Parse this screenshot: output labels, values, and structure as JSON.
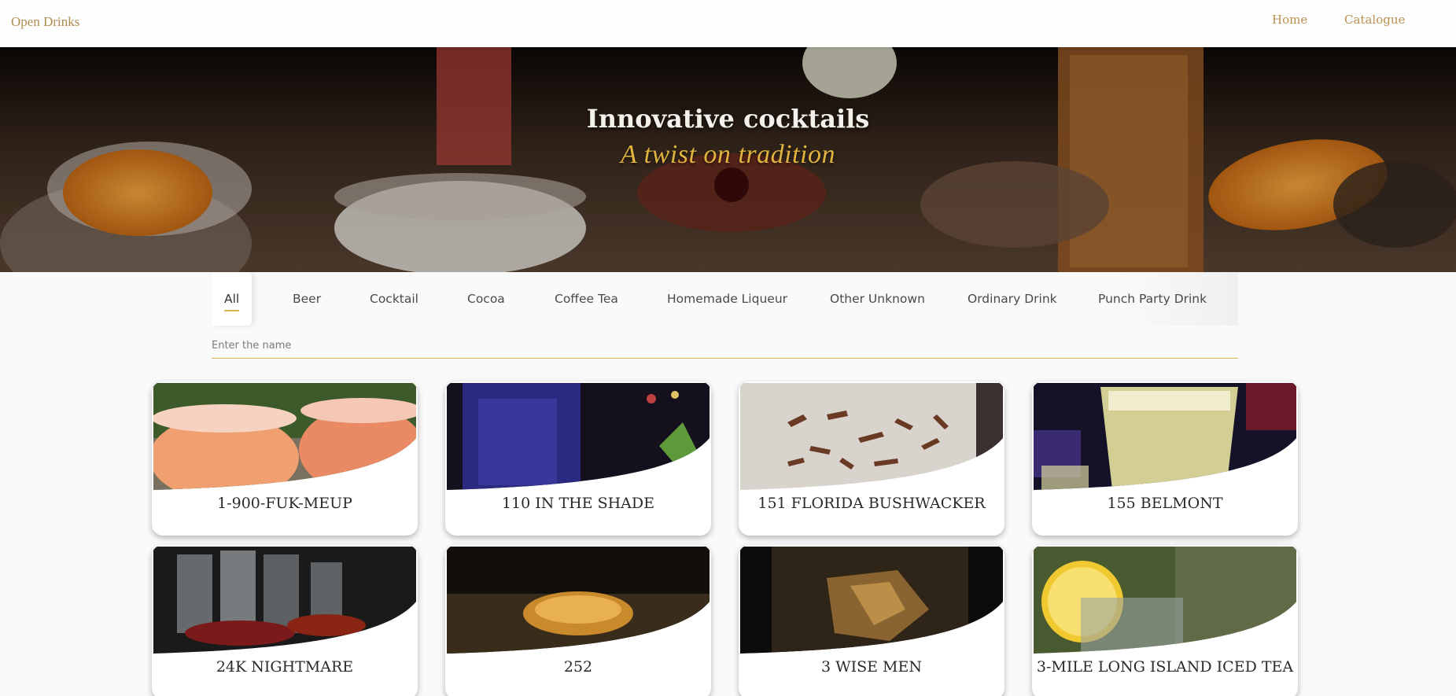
{
  "header": {
    "brand": "Open Drinks",
    "nav": [
      {
        "label": "Home"
      },
      {
        "label": "Catalogue"
      }
    ]
  },
  "hero": {
    "title": "Innovative cocktails",
    "subtitle": "A twist on tradition"
  },
  "tabs": {
    "active": "All",
    "items": [
      {
        "label": "All"
      },
      {
        "label": "Beer"
      },
      {
        "label": "Cocktail"
      },
      {
        "label": "Cocoa"
      },
      {
        "label": "Coffee Tea"
      },
      {
        "label": "Homemade Liqueur"
      },
      {
        "label": "Other Unknown"
      },
      {
        "label": "Ordinary Drink"
      },
      {
        "label": "Punch Party Drink"
      }
    ]
  },
  "search": {
    "placeholder": "Enter the name",
    "value": ""
  },
  "drinks": [
    {
      "name": "1-900-FUK-MEUP",
      "image": "pink-slush-cups"
    },
    {
      "name": "110 IN THE SHADE",
      "image": "blue-jar-mint"
    },
    {
      "name": "151 FLORIDA BUSHWACKER",
      "image": "chocolate-shavings"
    },
    {
      "name": "155 BELMONT",
      "image": "yellow-glass-bar"
    },
    {
      "name": "24K NIGHTMARE",
      "image": "bar-glasses"
    },
    {
      "name": "252",
      "image": "amber-shot-glass"
    },
    {
      "name": "3 WISE MEN",
      "image": "whiskey-ice"
    },
    {
      "name": "3-MILE LONG ISLAND ICED TEA",
      "image": "lemon-iced-tea"
    }
  ],
  "colors": {
    "accent": "#d8b64a",
    "brand": "#b08d4f",
    "subtitle": "#e0b43d"
  }
}
